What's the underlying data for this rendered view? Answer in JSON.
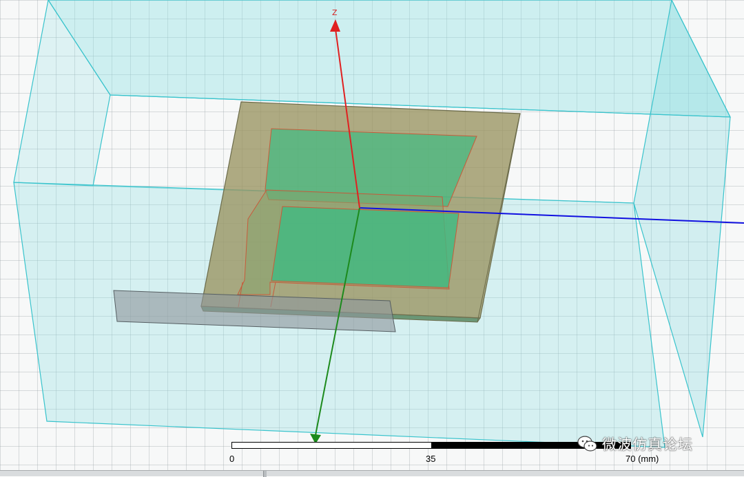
{
  "axes": {
    "z_label": "Z"
  },
  "scale_bar": {
    "ticks": [
      "0",
      "35",
      "70 (mm)"
    ]
  },
  "watermark": {
    "text": "微波仿真论坛",
    "icon": "wechat-icon"
  },
  "colors": {
    "airbox": "#5fd0d6",
    "substrate": "#8a9a60",
    "patch": "#3fb87a",
    "z_axis": "#e02020",
    "y_axis": "#1c8a1c",
    "x_axis": "#1010e0",
    "feed_port": "#9aa2a6"
  }
}
